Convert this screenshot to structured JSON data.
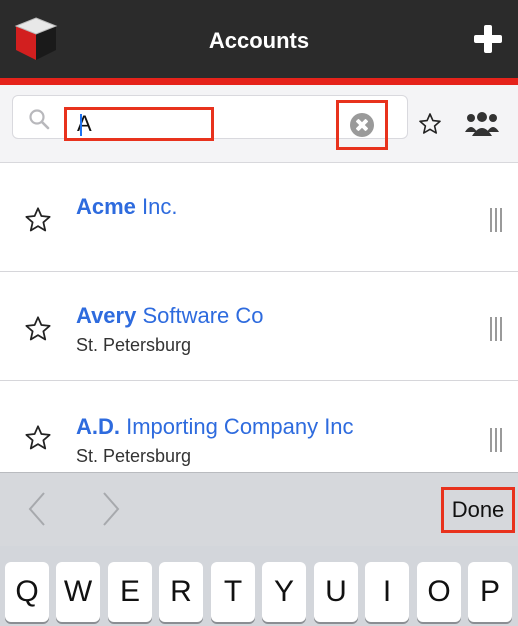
{
  "header": {
    "title": "Accounts",
    "logo_icon": "app-cube-logo-icon",
    "add_icon": "plus-icon",
    "colors": {
      "bar": "#2b2b2b",
      "accent_line": "#e5231b"
    }
  },
  "search": {
    "value": "A",
    "search_icon": "search-icon",
    "clear_icon": "clear-icon",
    "favorites_icon": "star-outline-icon",
    "my_items_icon": "group-icon",
    "highlight_color": "#e8321d"
  },
  "accounts": [
    {
      "name_match": "Acme",
      "name_rest": " Inc.",
      "city": ""
    },
    {
      "name_match": "Avery",
      "name_rest": " Software Co",
      "city": "St. Petersburg"
    },
    {
      "name_match": "A.D.",
      "name_rest": " Importing Company Inc",
      "city": "St. Petersburg"
    }
  ],
  "keyboard_toolbar": {
    "prev_icon": "chevron-left-icon",
    "next_icon": "chevron-right-icon",
    "done_label": "Done"
  },
  "keyboard": {
    "keys": [
      "Q",
      "W",
      "E",
      "R",
      "T",
      "Y",
      "U",
      "I",
      "O",
      "P"
    ]
  }
}
